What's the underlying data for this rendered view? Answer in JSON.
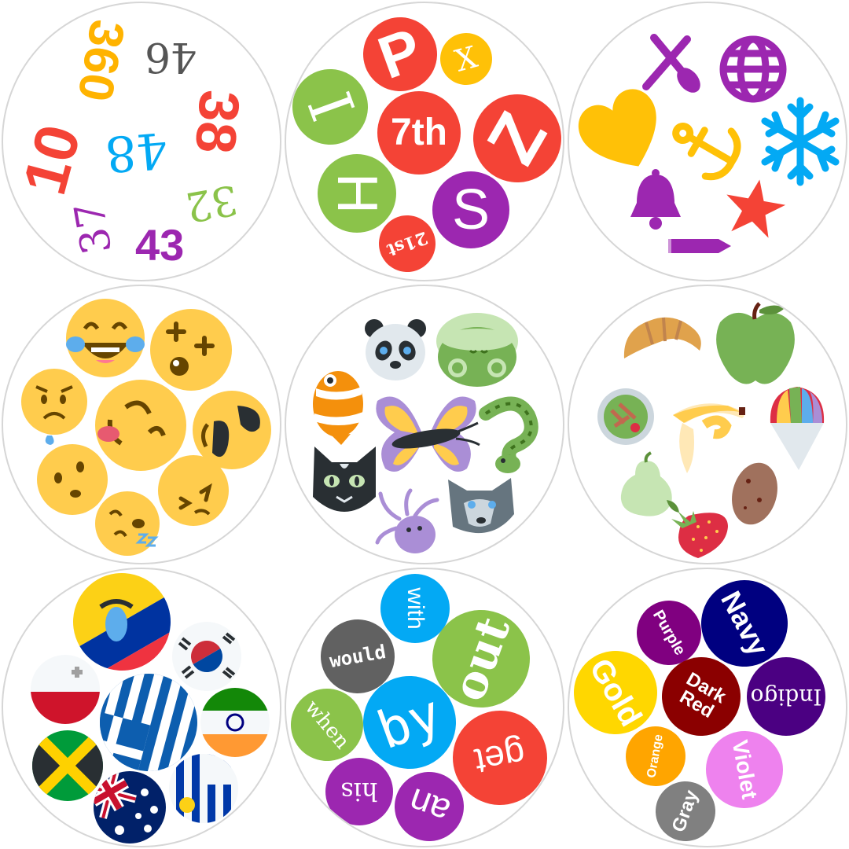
{
  "numbers_card": {
    "items": [
      {
        "text": "360",
        "color": "#ffb300"
      },
      {
        "text": "46",
        "color": "#555555"
      },
      {
        "text": "38",
        "color": "#f44336"
      },
      {
        "text": "10",
        "color": "#f44336"
      },
      {
        "text": "48",
        "color": "#03a9f4"
      },
      {
        "text": "32",
        "color": "#8bc34a"
      },
      {
        "text": "37",
        "color": "#9c27b0"
      },
      {
        "text": "43",
        "color": "#9c27b0"
      }
    ]
  },
  "letters_card": {
    "items": [
      {
        "text": "P",
        "color": "#f44336"
      },
      {
        "text": "X",
        "color": "#ffc107"
      },
      {
        "text": "I",
        "color": "#8bc34a"
      },
      {
        "text": "7th",
        "color": "#f44336"
      },
      {
        "text": "Z",
        "color": "#f44336"
      },
      {
        "text": "H",
        "color": "#8bc34a"
      },
      {
        "text": "S",
        "color": "#9c27b0"
      },
      {
        "text": "21st",
        "color": "#f44336"
      }
    ]
  },
  "symbols_card": {
    "icons": [
      "fork-knife-icon",
      "globe-icon",
      "heart-icon",
      "anchor-icon",
      "snowflake-icon",
      "bell-icon",
      "star-icon",
      "pencil-icon"
    ],
    "colors": {
      "purple": "#9c27b0",
      "yellow": "#ffc107",
      "blue": "#03a9f4",
      "red": "#f44336"
    }
  },
  "faces_card": {
    "icons": [
      "tears-of-joy-face-icon",
      "dizzy-face-icon",
      "worried-face-icon",
      "tongue-face-icon",
      "sunglasses-face-icon",
      "hushed-face-icon",
      "squinting-face-icon",
      "sleeping-face-icon"
    ]
  },
  "animals_card": {
    "icons": [
      "panda-icon",
      "turtle-icon",
      "clownfish-icon",
      "butterfly-icon",
      "snake-icon",
      "cat-icon",
      "wolf-icon",
      "octopus-icon"
    ]
  },
  "food_card": {
    "icons": [
      "croissant-icon",
      "green-apple-icon",
      "salad-icon",
      "banana-icon",
      "shaved-ice-icon",
      "pear-icon",
      "potato-icon",
      "strawberry-icon"
    ]
  },
  "flags_card": {
    "icons": [
      "ecuador-flag-icon",
      "south-korea-flag-icon",
      "malta-flag-icon",
      "greece-flag-icon",
      "india-flag-icon",
      "jamaica-flag-icon",
      "australia-flag-icon",
      "uruguay-flag-icon"
    ]
  },
  "words_card": {
    "items": [
      {
        "text": "with",
        "color": "#03a9f4"
      },
      {
        "text": "would",
        "color": "#616161"
      },
      {
        "text": "out",
        "color": "#8bc34a"
      },
      {
        "text": "when",
        "color": "#8bc34a"
      },
      {
        "text": "by",
        "color": "#03a9f4"
      },
      {
        "text": "get",
        "color": "#f44336"
      },
      {
        "text": "his",
        "color": "#9c27b0"
      },
      {
        "text": "an",
        "color": "#9c27b0"
      }
    ]
  },
  "colors_card": {
    "items": [
      {
        "text": "Purple",
        "color": "#800080"
      },
      {
        "text": "Navy",
        "color": "#000080"
      },
      {
        "text": "Gold",
        "color": "#ffd700"
      },
      {
        "text": "Dark Red",
        "color": "#8b0000"
      },
      {
        "text": "Indigo",
        "color": "#4b0082"
      },
      {
        "text": "Orange",
        "color": "#ffa500"
      },
      {
        "text": "Violet",
        "color": "#ee82ee"
      },
      {
        "text": "Gray",
        "color": "#808080"
      }
    ]
  }
}
